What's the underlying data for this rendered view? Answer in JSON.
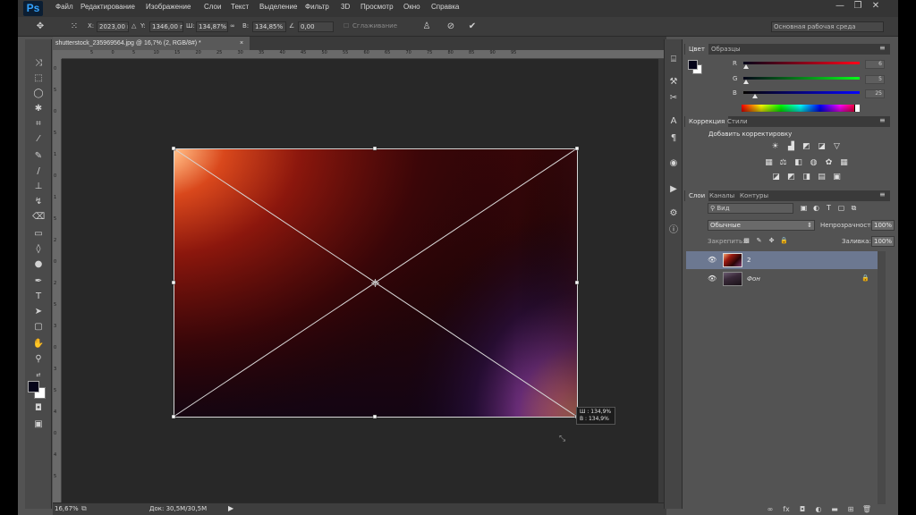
{
  "app": {
    "logo": "Ps"
  },
  "menu": {
    "items": [
      "Файл",
      "Редактирование",
      "Изображение",
      "Слои",
      "Текст",
      "Выделение",
      "Фильтр",
      "3D",
      "Просмотр",
      "Окно",
      "Справка"
    ]
  },
  "window_controls": {
    "minimize": "—",
    "restore": "❐",
    "close": "✕"
  },
  "options": {
    "x_label": "X:",
    "x_value": "2023,00 п",
    "y_label": "Y:",
    "y_value": "1346,00 п",
    "w_label": "Ш:",
    "w_value": "134,87%",
    "h_label": "В:",
    "h_value": "134,85%",
    "angle_label": "∠",
    "angle_value": "0,00",
    "smoothing_label": "Сглаживание",
    "workspace": "Основная рабочая среда"
  },
  "document": {
    "tab_title": "shutterstock_235969564.jpg @ 16,7% (2, RGB/8#) *",
    "tab_close": "×",
    "ruler_top": [
      "5",
      "0",
      "5",
      "10",
      "15",
      "20",
      "25",
      "30",
      "35",
      "40",
      "45",
      "50",
      "55",
      "60",
      "65",
      "70",
      "75",
      "80",
      "85",
      "90",
      "95"
    ],
    "ruler_left": [
      "0",
      "5",
      "0",
      "5",
      "1",
      "0",
      "1",
      "5",
      "2",
      "0",
      "2",
      "5",
      "3",
      "0",
      "3",
      "5",
      "4",
      "0",
      "4",
      "5"
    ],
    "tooltip": {
      "w": "Ш :  134,9%",
      "h": "В :  134,9%"
    }
  },
  "status": {
    "zoom": "16,67%",
    "doc_size": "Док: 30,5M/30,5M"
  },
  "color_panel": {
    "tabs": [
      "Цвет",
      "Образцы"
    ],
    "r_label": "R",
    "g_label": "G",
    "b_label": "B",
    "r_value": "6",
    "g_value": "5",
    "b_value": "25",
    "r_level": 0.024,
    "g_level": 0.02,
    "b_level": 0.098,
    "foreground": "#06051a",
    "background": "#ffffff"
  },
  "adjustments_panel": {
    "tabs": [
      "Коррекция",
      "Стили"
    ],
    "title": "Добавить корректировку"
  },
  "layers_panel": {
    "tabs": [
      "Слои",
      "Каналы",
      "Контуры"
    ],
    "kind_filter": "Вид",
    "blend_mode": "Обычные",
    "opacity_label": "Непрозрачность:",
    "opacity_value": "100%",
    "lock_label": "Закрепить:",
    "fill_label": "Заливка:",
    "fill_value": "100%",
    "layers": [
      {
        "name": "2",
        "selected": true
      },
      {
        "name": "Фон",
        "selected": false
      }
    ]
  }
}
